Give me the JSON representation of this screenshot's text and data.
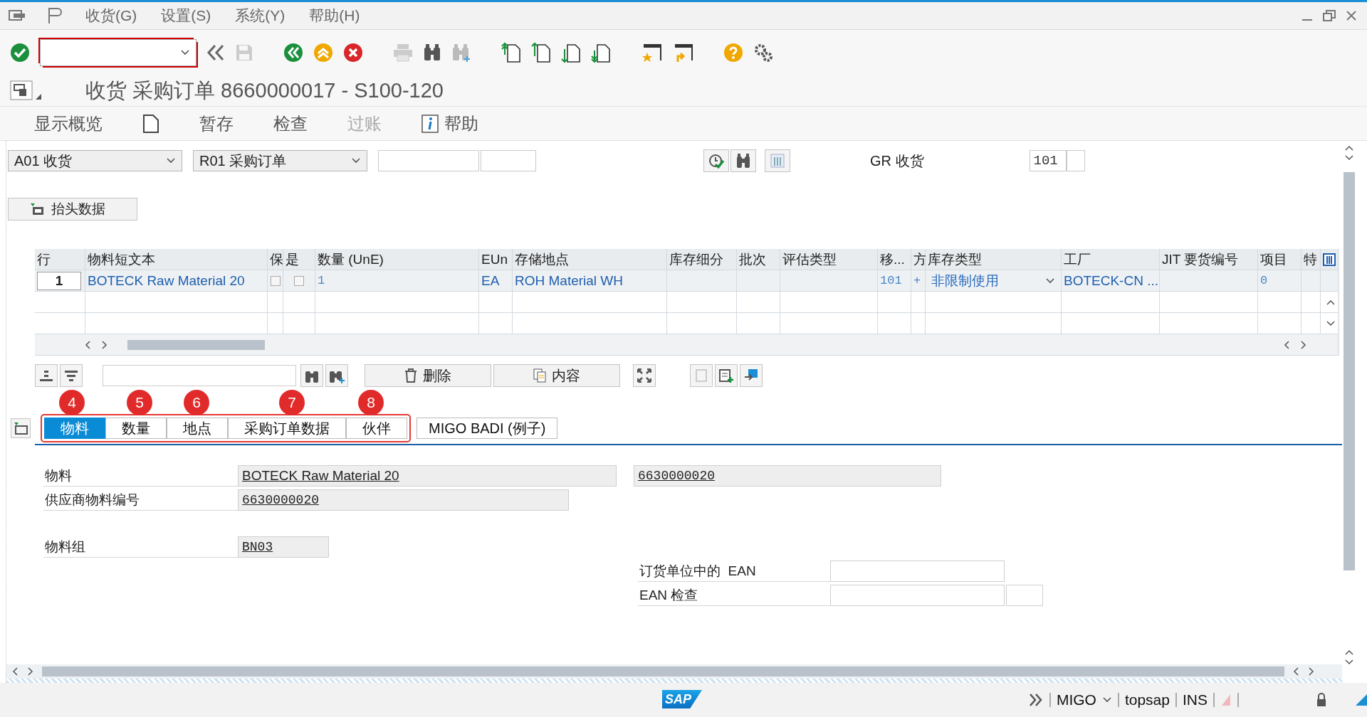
{
  "menu_bar": {
    "items": [
      "收货(G)",
      "设置(S)",
      "系统(Y)",
      "帮助(H)"
    ]
  },
  "title": "收货 采购订单 8660000017 - S100-120",
  "app_toolbar": [
    {
      "kind": "text",
      "label": "显示概览",
      "disabled": false
    },
    {
      "kind": "document"
    },
    {
      "kind": "text",
      "label": "暂存",
      "disabled": false
    },
    {
      "kind": "text",
      "label": "检查",
      "disabled": false
    },
    {
      "kind": "text",
      "label": "过账",
      "disabled": true
    },
    {
      "kind": "info",
      "label": "帮助",
      "disabled": false
    }
  ],
  "selection": {
    "action": "A01 收货",
    "reference": "R01 采购订单",
    "movement_label": "GR 收货",
    "movement_type": "101"
  },
  "header_button": "抬头数据",
  "items_table": {
    "columns": [
      "行",
      "物料短文本",
      "保",
      "是",
      "数量 (UnE)",
      "EUn",
      "存储地点",
      "库存细分",
      "批次",
      "评估类型",
      "移...",
      "方",
      "库存类型",
      "工厂",
      "JIT 要货编号",
      "项目",
      "特"
    ],
    "rows": [
      {
        "line": "1",
        "short_text": "BOTECK Raw Material 20",
        "column_3_checked": false,
        "column_4_checked": false,
        "quantity": "1",
        "unit": "EA",
        "storage_location": "ROH Material WH",
        "movement_type": "101",
        "direction": "+",
        "stock_type": "非限制使用",
        "plant": "BOTECK-CN ...",
        "item": "0"
      }
    ]
  },
  "table_toolbar": {
    "delete": "删除",
    "content": "内容"
  },
  "callouts": [
    "4",
    "5",
    "6",
    "7",
    "8"
  ],
  "tabs": [
    {
      "label": "物料",
      "selected": true
    },
    {
      "label": "数量",
      "selected": false
    },
    {
      "label": "地点",
      "selected": false
    },
    {
      "label": "采购订单数据",
      "selected": false
    },
    {
      "label": "伙伴",
      "selected": false
    },
    {
      "label": "MIGO BADI (例子)",
      "selected": false
    }
  ],
  "detail": {
    "material": {
      "label": "物料",
      "value": "BOTECK Raw Material 20",
      "number": "6630000020"
    },
    "vendor_material": {
      "label": "供应商物料编号",
      "value": "6630000020"
    },
    "material_group": {
      "label": "物料组",
      "value": "BN03"
    },
    "ean_order_unit": {
      "label": "订货单位中的  EAN"
    },
    "ean_check": {
      "label": "EAN 检查"
    }
  },
  "status_bar": {
    "logo": "SAP",
    "transaction": "MIGO",
    "user": "topsap",
    "mode": "INS"
  }
}
